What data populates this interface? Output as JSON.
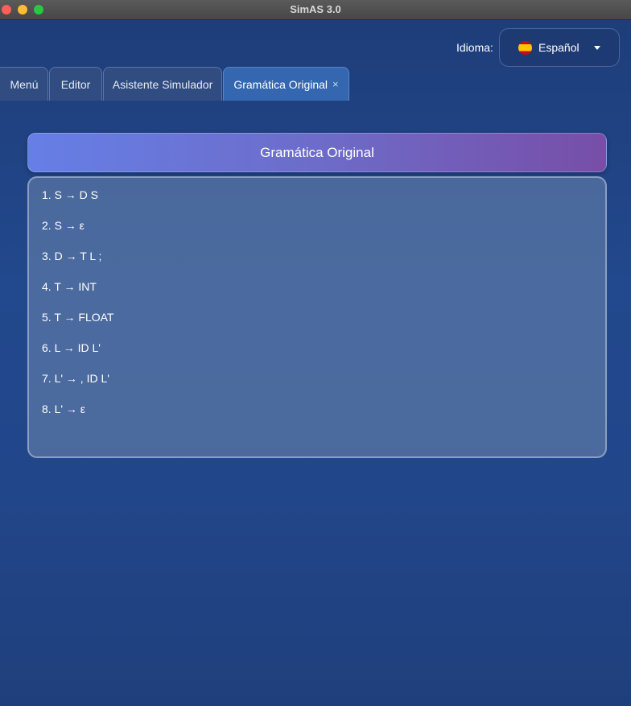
{
  "window": {
    "title": "SimAS 3.0"
  },
  "language": {
    "label": "Idioma:",
    "value": "Español",
    "flag_icon": "spain-flag-icon"
  },
  "tabs": [
    {
      "label": "Menú",
      "active": false
    },
    {
      "label": "Editor",
      "active": false
    },
    {
      "label": "Asistente Simulador",
      "active": false
    },
    {
      "label": "Gramática Original",
      "active": true,
      "close": "×"
    }
  ],
  "panel": {
    "title": "Gramática Original",
    "rules": [
      "1. S → D S",
      "2. S → ε",
      "3. D → T L ;",
      "4. T → INT",
      "5. T → FLOAT",
      "6. L → ID L'",
      "7. L' → , ID L'",
      "8. L' → ε"
    ]
  }
}
